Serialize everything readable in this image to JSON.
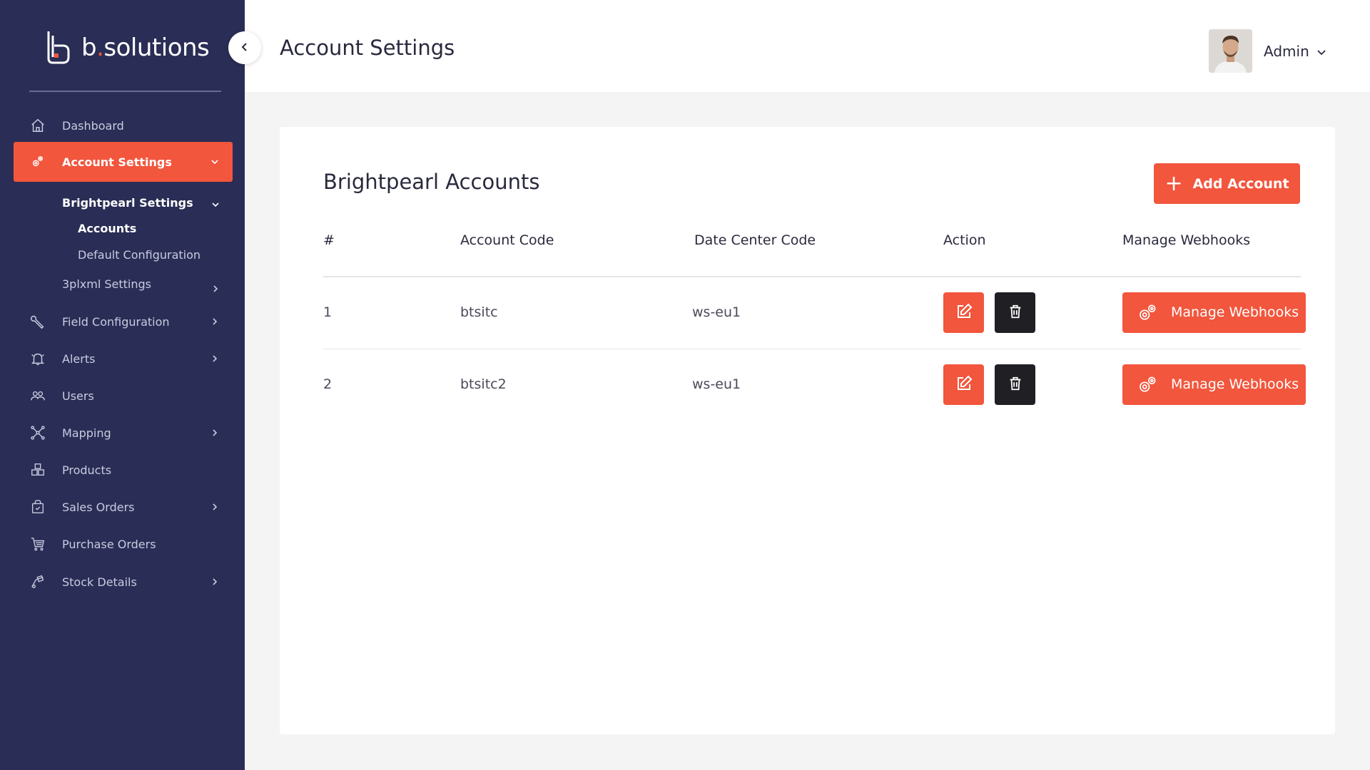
{
  "brand": {
    "name_prefix": "b",
    "name_dot": ".",
    "name_suffix": "solutions",
    "accent": "#f2563d",
    "sidebar_bg": "#2a2d55"
  },
  "header": {
    "title": "Account Settings",
    "user_name": "Admin"
  },
  "sidebar": {
    "items": [
      {
        "label": "Dashboard",
        "icon": "home-icon"
      },
      {
        "label": "Account Settings",
        "icon": "settings-gears-icon"
      },
      {
        "label": "Field Configuration",
        "icon": "wrench-icon"
      },
      {
        "label": "Alerts",
        "icon": "bell-icon"
      },
      {
        "label": "Users",
        "icon": "users-icon"
      },
      {
        "label": "Mapping",
        "icon": "mapping-icon"
      },
      {
        "label": "Products",
        "icon": "boxes-icon"
      },
      {
        "label": "Sales Orders",
        "icon": "shopping-bag-icon"
      },
      {
        "label": "Purchase Orders",
        "icon": "cart-icon"
      },
      {
        "label": "Stock Details",
        "icon": "dolly-icon"
      }
    ],
    "sub_items": {
      "brightpearl_settings": "Brightpearl Settings",
      "accounts": "Accounts",
      "default_configuration": "Default Configuration",
      "threeplxml_settings": "3plxml Settings"
    }
  },
  "main": {
    "card_title": "Brightpearl Accounts",
    "add_button": "Add Account",
    "columns": [
      "#",
      "Account Code",
      "Date Center Code",
      "Action",
      "Manage Webhooks"
    ],
    "rows": [
      {
        "index": "1",
        "account_code": "btsitc",
        "data_center": "ws-eu1",
        "webhook_label": "Manage Webhooks"
      },
      {
        "index": "2",
        "account_code": "btsitc2",
        "data_center": "ws-eu1",
        "webhook_label": "Manage Webhooks"
      }
    ]
  }
}
